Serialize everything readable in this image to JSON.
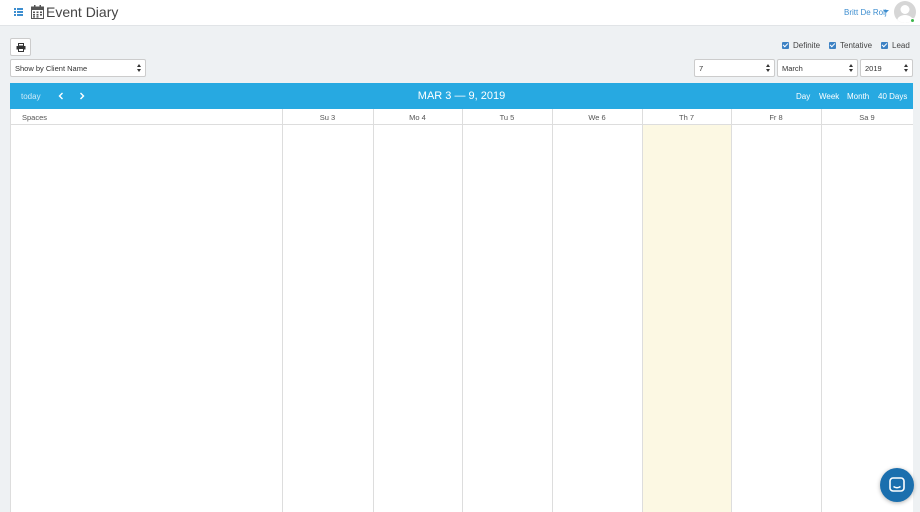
{
  "app": {
    "title": "Event Diary"
  },
  "user": {
    "name": "Britt De Roij"
  },
  "filters": [
    {
      "label": "Definite",
      "checked": true
    },
    {
      "label": "Tentative",
      "checked": true
    },
    {
      "label": "Lead",
      "checked": true
    }
  ],
  "show_by": {
    "selected": "Show by Client Name"
  },
  "date_picker": {
    "day": "7",
    "month": "March",
    "year": "2019"
  },
  "calendar": {
    "today_label": "today",
    "title": "MAR 3 — 9, 2019",
    "views": [
      "Day",
      "Week",
      "Month",
      "40 Days"
    ],
    "resource_header": "Spaces",
    "days": [
      "Su 3",
      "Mo 4",
      "Tu 5",
      "We 6",
      "Th 7",
      "Fr 8",
      "Sa 9"
    ],
    "highlighted_day": "Th 7"
  },
  "colors": {
    "accent": "#27a9e1",
    "link": "#3d8ed0",
    "today_bg": "#fcf8e3",
    "chat": "#1b6fae"
  },
  "icons": [
    "menu-icon",
    "calendar-icon",
    "print-icon",
    "chevron-left-icon",
    "chevron-right-icon",
    "chat-icon"
  ]
}
